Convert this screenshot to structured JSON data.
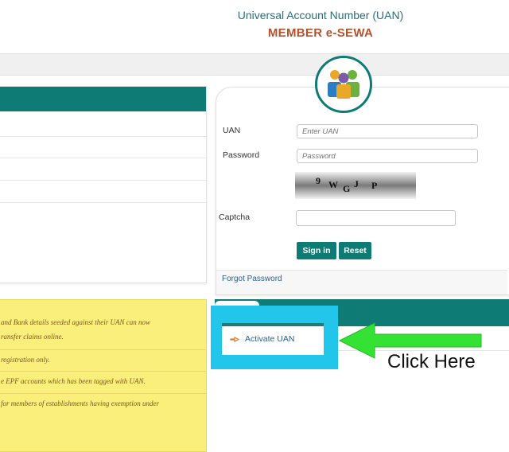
{
  "header": {
    "title": "Universal Account Number (UAN)",
    "subtitle": "MEMBER e-SEWA"
  },
  "login": {
    "uan_label": "UAN",
    "uan_placeholder": "Enter UAN",
    "password_label": "Password",
    "password_placeholder": "Password",
    "captcha_text": "9 W G J P",
    "captcha_label": "Captcha",
    "sign_in_label": "Sign in",
    "reset_label": "Reset",
    "forgot_label": "Forgot Password"
  },
  "notices": [
    "and Bank details seeded against their UAN can now",
    "ransfer claims online.",
    "registration only.",
    "e EPF accounts which has been tagged with UAN.",
    "for members of establishments having exemption under"
  ],
  "activate": {
    "link_label": "Activate UAN"
  },
  "annotation": {
    "click_here": "Click Here",
    "highlight_color": "#22c6ea",
    "arrow_color": "#33e233"
  },
  "colors": {
    "brand_teal": "#0e7c75",
    "title_teal": "#2b6e7a",
    "subtitle_orange": "#b5522e",
    "notice_yellow": "#fbef7c"
  },
  "icons": {
    "avatar": "users-group-icon",
    "activate": "hand-pointer-icon"
  }
}
